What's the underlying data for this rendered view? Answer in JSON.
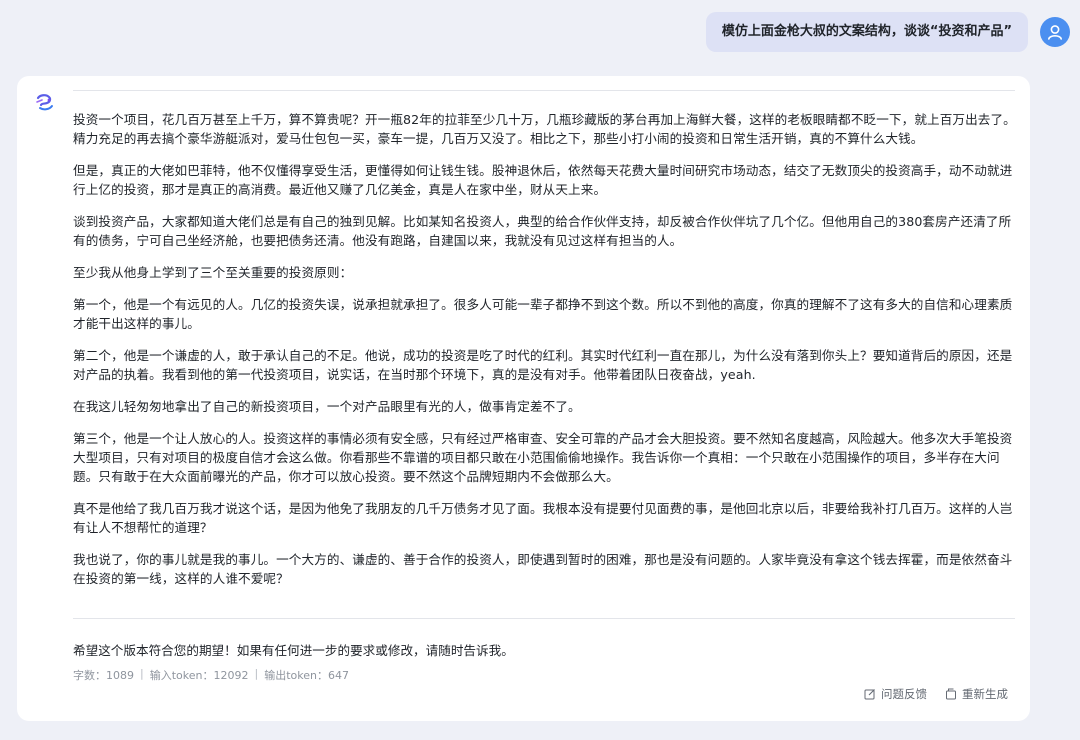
{
  "user": {
    "message": "模仿上面金枪大叔的文案结构，谈谈“投资和产品”",
    "avatar_icon": "user-icon"
  },
  "assistant": {
    "avatar_icon": "bot-logo-icon",
    "paragraphs": [
      "投资一个项目，花几百万甚至上千万，算不算贵呢？开一瓶82年的拉菲至少几十万，几瓶珍藏版的茅台再加上海鲜大餐，这样的老板眼睛都不眨一下，就上百万出去了。精力充足的再去搞个豪华游艇派对，爱马仕包包一买，豪车一提，几百万又没了。相比之下，那些小打小闹的投资和日常生活开销，真的不算什么大钱。",
      "但是，真正的大佬如巴菲特，他不仅懂得享受生活，更懂得如何让钱生钱。股神退休后，依然每天花费大量时间研究市场动态，结交了无数顶尖的投资高手，动不动就进行上亿的投资，那才是真正的高消费。最近他又赚了几亿美金，真是人在家中坐，财从天上来。",
      "谈到投资产品，大家都知道大佬们总是有自己的独到见解。比如某知名投资人，典型的给合作伙伴支持，却反被合作伙伴坑了几个亿。但他用自己的380套房产还清了所有的债务，宁可自己坐经济舱，也要把债务还清。他没有跑路，自建国以来，我就没有见过这样有担当的人。",
      "至少我从他身上学到了三个至关重要的投资原则：",
      "第一个，他是一个有远见的人。几亿的投资失误，说承担就承担了。很多人可能一辈子都挣不到这个数。所以不到他的高度，你真的理解不了这有多大的自信和心理素质才能干出这样的事儿。",
      "第二个，他是一个谦虚的人，敢于承认自己的不足。他说，成功的投资是吃了时代的红利。其实时代红利一直在那儿，为什么没有落到你头上？要知道背后的原因，还是对产品的执着。我看到他的第一代投资项目，说实话，在当时那个环境下，真的是没有对手。他带着团队日夜奋战，yeah.",
      "在我这儿轻匆匆地拿出了自己的新投资项目，一个对产品眼里有光的人，做事肯定差不了。",
      "第三个，他是一个让人放心的人。投资这样的事情必须有安全感，只有经过严格审查、安全可靠的产品才会大胆投资。要不然知名度越高，风险越大。他多次大手笔投资大型项目，只有对项目的极度自信才会这么做。你看那些不靠谱的项目都只敢在小范围偷偷地操作。我告诉你一个真相：一个只敢在小范围操作的项目，多半存在大问题。只有敢于在大众面前曝光的产品，你才可以放心投资。要不然这个品牌短期内不会做那么大。",
      "真不是他给了我几百万我才说这个话，是因为他免了我朋友的几千万债务才见了面。我根本没有提要付见面费的事，是他回北京以后，非要给我补打几百万。这样的人岂有让人不想帮忙的道理？",
      "我也说了，你的事儿就是我的事儿。一个大方的、谦虚的、善于合作的投资人，即使遇到暂时的困难，那也是没有问题的。人家毕竟没有拿这个钱去挥霍，而是依然奋斗在投资的第一线，这样的人谁不爱呢？"
    ],
    "closing": "希望这个版本符合您的期望！如果有任何进一步的要求或修改，请随时告诉我。",
    "stats": {
      "word_count": "字数：1089",
      "input_tokens": "输入token：12092",
      "output_tokens": "输出token：647",
      "separator": "|"
    },
    "actions": {
      "feedback_label": "问题反馈",
      "regenerate_label": "重新生成"
    }
  },
  "colors": {
    "background": "#eef0f7",
    "user_bubble": "#dde1f5",
    "user_avatar": "#4b8ff0",
    "card": "#ffffff",
    "muted_text": "#8f959e"
  }
}
